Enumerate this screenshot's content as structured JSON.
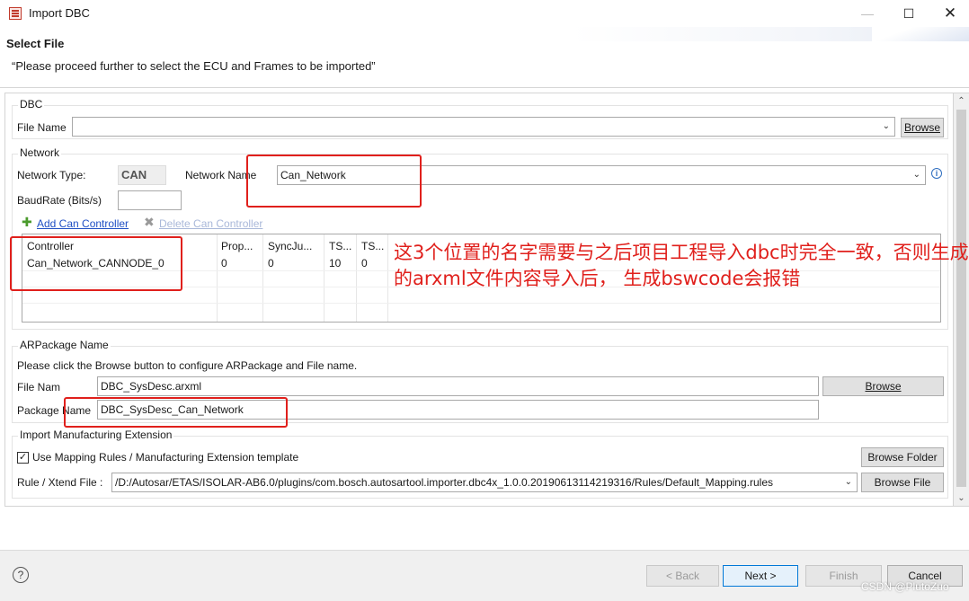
{
  "window": {
    "title": "Import DBC",
    "min": "—",
    "max": "☐",
    "close": "✕"
  },
  "header": {
    "title": "Select File",
    "description": "“Please proceed further to select the ECU and Frames to be imported”"
  },
  "dbc": {
    "legend": "DBC",
    "file_name_label": "File Name",
    "file_name_value": "",
    "browse": "Browse"
  },
  "network": {
    "legend": "Network",
    "type_label": "Network Type:",
    "type_value": "CAN",
    "name_label": "Network Name",
    "name_value": "Can_Network",
    "baud_label": "BaudRate (Bits/s)",
    "baud_value": "",
    "add_controller": "Add Can Controller",
    "delete_controller": "Delete Can Controller"
  },
  "controller_table": {
    "columns": [
      "Controller",
      "Prop...",
      "SyncJu...",
      "TS...",
      "TS..."
    ],
    "rows": [
      [
        "Can_Network_CANNODE_0",
        "0",
        "0",
        "10",
        "0"
      ]
    ]
  },
  "arpackage": {
    "legend": "ARPackage Name",
    "hint": "Please click the Browse button to configure ARPackage and File name.",
    "file_label": "File Nam",
    "file_value": "DBC_SysDesc.arxml",
    "browse": "Browse",
    "package_label": "Package Name",
    "package_value": "DBC_SysDesc_Can_Network"
  },
  "manufacturing": {
    "legend": "Import Manufacturing Extension",
    "checkbox_label": "Use Mapping Rules / Manufacturing Extension template",
    "checkbox_checked": true,
    "browse_folder": "Browse Folder",
    "rule_label": "Rule / Xtend File :",
    "rule_value": "/D:/Autosar/ETAS/ISOLAR-AB6.0/plugins/com.bosch.autosartool.importer.dbc4x_1.0.0.20190613114219316/Rules/Default_Mapping.rules",
    "browse_file": "Browse File"
  },
  "annotation": "这3个位置的名字需要与之后项目工程导入dbc时完全一致，否则生成的arxml文件内容导入后， 生成bswcode会报错",
  "footer": {
    "help": "?",
    "back": "< Back",
    "next": "Next >",
    "finish": "Finish",
    "cancel": "Cancel"
  },
  "watermark": "CSDN @PlutoZuo",
  "colors": {
    "annotation": "#e0201c",
    "link": "#1f4fc4",
    "primary_border": "#0078d7"
  }
}
